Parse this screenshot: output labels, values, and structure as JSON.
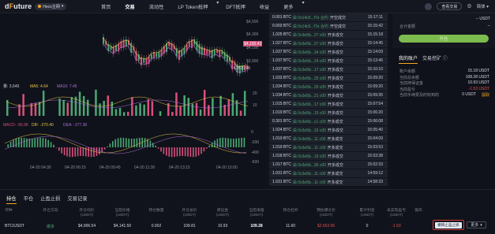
{
  "nav": {
    "logo_main": "d",
    "logo_accent": "F",
    "logo_rest": "uture",
    "network": "Heco主网",
    "items": [
      "首页",
      "交易",
      "流动性",
      "LP Token抵押",
      "DFT抵押",
      "收益",
      "更多"
    ],
    "active_index": 1,
    "connect": "查看交易",
    "language": "简体"
  },
  "chart": {
    "price_labels": [
      "$4,500",
      "$4,300",
      "$4,150.43",
      "$4,100",
      "$3,900"
    ],
    "low_label": "$3526.99",
    "vol_legend": {
      "vol": "量: 3,649",
      "ma5": "MA5: 4.64",
      "ma10": "MA10: 7.45"
    },
    "vol_axis": [
      "20",
      "10"
    ],
    "macd_legend": {
      "macd": "MACD: -95.96",
      "dif": "DIF: -270.40",
      "dea": "DEA: -177.38"
    },
    "macd_axis": [
      "0",
      "-200",
      "-400",
      "-600"
    ],
    "time_labels": [
      "04-20 04:30",
      "04-20 06:15",
      "04-20 09:45",
      "04-20 11:30",
      "04-20 13:15",
      "04-20 15:00"
    ]
  },
  "orderbook": {
    "rows": [
      {
        "amt": "0.001 BTC",
        "addr": "由 0x14c5...f7e 合约",
        "act": "开空成交",
        "time": "15:17:11"
      },
      {
        "amt": "0.003 BTC",
        "addr": "由 0x14c5...f7e 合约",
        "act": "开空成交",
        "time": "15:15:42"
      },
      {
        "amt": "1.025 BTC",
        "addr": "由 0x3e5b...27 c00",
        "act": "开多成交",
        "time": "15:15:18"
      },
      {
        "amt": "1.027 BTC",
        "addr": "由 0x3e5b...27 c00",
        "act": "开多成交",
        "time": "15:14:45"
      },
      {
        "amt": "1.037 BTC",
        "addr": "由 0x3e5b...34 c00",
        "act": "开多成交",
        "time": "15:14:09"
      },
      {
        "amt": "1.037 BTC",
        "addr": "由 0x3e5b...24 c00",
        "act": "开多成交",
        "time": "15:13:46"
      },
      {
        "amt": "1.037 BTC",
        "addr": "由 0x3e5b...17 c00",
        "act": "开多成交",
        "time": "15:10:10"
      },
      {
        "amt": "1.033 BTC",
        "addr": "由 0x3e5b...25 c00",
        "act": "开多成交",
        "time": "15:09:20"
      },
      {
        "amt": "1.034 BTC",
        "addr": "由 0x3e5b...25 c00",
        "act": "开多成交",
        "time": "15:09:20"
      },
      {
        "amt": "1.034 BTC",
        "addr": "由 0x3e5b...21 c00",
        "act": "开多成交",
        "time": "15:09:35"
      },
      {
        "amt": "1.015 BTC",
        "addr": "由 0x3e5b...17 c00",
        "act": "开多成交",
        "time": "15:07:54"
      },
      {
        "amt": "1.019 BTC",
        "addr": "由 0x3e5b...15 c00",
        "act": "开多成交",
        "time": "15:06:20"
      },
      {
        "amt": "0.301 BTC",
        "addr": "由 0x3e5b...c1 c00",
        "act": "开多成交",
        "time": "15:06:08"
      },
      {
        "amt": "1.024 BTC",
        "addr": "由 0x3e5b...16 c00",
        "act": "开多成交",
        "time": "15:05:40"
      },
      {
        "amt": "1.019 BTC",
        "addr": "由 0x3e5b...11 c00",
        "act": "开多成交",
        "time": "15:04:09"
      },
      {
        "amt": "1.019 BTC",
        "addr": "由 0x3e5b...11 c00",
        "act": "开多成交",
        "time": "15:03:53"
      },
      {
        "amt": "1.018 BTC",
        "addr": "由 0x3e5b...19 c00",
        "act": "开多成交",
        "time": "15:03:38"
      },
      {
        "amt": "1.017 BTC",
        "addr": "由 0x3e5b...36 c00",
        "act": "开多成交",
        "time": "15:02:33"
      },
      {
        "amt": "1.031 BTC",
        "addr": "由 0x3e5b...11 c00",
        "act": "开多成交",
        "time": "14:59:12"
      },
      {
        "amt": "1.031 BTC",
        "addr": "由 0x3e5b...11 c00",
        "act": "开多成交",
        "time": "14:58:33"
      }
    ]
  },
  "right_panel": {
    "top_row1_label": "",
    "top_row1_val": "-- USDT",
    "top_row2_label": "合计金额",
    "top_row2_val": "--",
    "open_button": "开仓",
    "tab1": "我的账户",
    "tab2": "交易挖矿",
    "account": [
      {
        "label": "账户余额",
        "value": "15.18 USDT"
      },
      {
        "label": "当前总余额",
        "value": "108.28 USDT"
      },
      {
        "label": "当前持保证金",
        "value": "10.93 USDT"
      },
      {
        "label": "当前盈亏",
        "value": "-1.53 USDT"
      },
      {
        "label": "当前手续费及时收到的",
        "value": "0 USDT"
      }
    ],
    "withdraw": "提取"
  },
  "bottom": {
    "tabs": [
      "持仓",
      "平仓",
      "止盈止损",
      "交易记录"
    ],
    "headers": [
      "币种",
      "开仓方向",
      "开仓均价\n(USDT)",
      "当前价格\n(USDT)",
      "持仓数量",
      "开仓总价\n(USDT)",
      "保证金\n(USDT)",
      "当前净值\n(USDT)",
      "持仓杠杆",
      "预估爆仓价\n(USDT)",
      "累计利息\n(USDT)",
      "未实现盈亏\n(USDT)",
      "操作"
    ],
    "row": [
      "BTC/USDT",
      "做多",
      "$4,906.54",
      "$4,141.50",
      "0.002",
      "109.81",
      "10.93",
      "109.28",
      "11.60",
      "$2,563.96",
      "0",
      "-1.53"
    ],
    "close_button": "撤销止盈止损",
    "more_button": "更多"
  }
}
